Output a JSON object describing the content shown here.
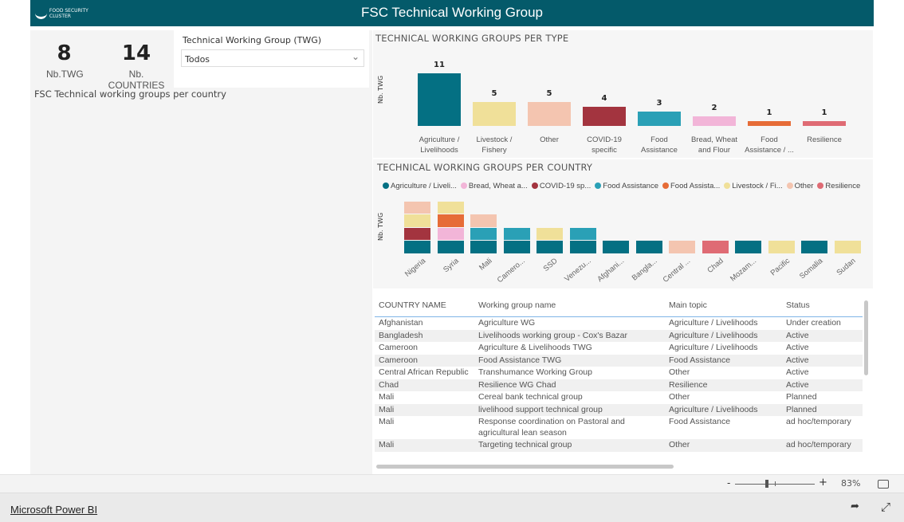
{
  "header": {
    "title": "FSC Technical Working Group",
    "logo_text": "FOOD SECURITY CLUSTER"
  },
  "kpis": [
    {
      "value": "8",
      "label": "Nb.TWG"
    },
    {
      "value": "14",
      "label": "Nb. COUNTRIES"
    }
  ],
  "slicer": {
    "title": "Technical Working Group (TWG)",
    "value": "Todos"
  },
  "left_title": "FSC Technical working groups per country",
  "colors": {
    "header": "#045a6a",
    "Agriculture / Livelihoods": "#047083",
    "Livestock / Fishery": "#f0e099",
    "Other": "#f4c5b0",
    "COVID-19 specific": "#a3343f",
    "Food Assistance": "#2aa0b6",
    "Bread, Wheat and Flour": "#f2b5d8",
    "Food Assistance / ...": "#e66c37",
    "Resilience": "#df6b74"
  },
  "chart_data": [
    {
      "type": "bar",
      "title": "TECHNICAL WORKING GROUPS PER TYPE",
      "ylabel": "Nb. TWG",
      "xlabel": "",
      "categories": [
        "Agriculture / Livelihoods",
        "Livestock / Fishery",
        "Other",
        "COVID-19 specific",
        "Food Assistance",
        "Bread, Wheat and Flour",
        "Food Assistance / ...",
        "Resilience"
      ],
      "values": [
        11,
        5,
        5,
        4,
        3,
        2,
        1,
        1
      ],
      "data_labels": true
    },
    {
      "type": "bar",
      "stacked": true,
      "title": "TECHNICAL WORKING GROUPS PER COUNTRY",
      "ylabel": "Nb. TWG",
      "legend_position": "top",
      "legend": [
        "Agriculture / Liveli...",
        "Bread, Wheat a...",
        "COVID-19 sp...",
        "Food Assistance",
        "Food Assista...",
        "Livestock / Fi...",
        "Other",
        "Resilience"
      ],
      "categories": [
        "Nigeria",
        "Syria",
        "Mali",
        "Camero...",
        "SSD",
        "Venezu...",
        "Afghani...",
        "Bangla...",
        "Central ...",
        "Chad",
        "Mozam...",
        "Pacific",
        "Somalia",
        "Sudan"
      ],
      "series": [
        {
          "name": "Agriculture / Livelihoods",
          "values": [
            1,
            1,
            1,
            1,
            1,
            1,
            1,
            1,
            0,
            0,
            1,
            0,
            1,
            0
          ]
        },
        {
          "name": "Bread, Wheat and Flour",
          "values": [
            0,
            1,
            0,
            0,
            0,
            0,
            0,
            0,
            0,
            0,
            0,
            0,
            0,
            0
          ]
        },
        {
          "name": "COVID-19 specific",
          "values": [
            1,
            0,
            0,
            0,
            0,
            0,
            0,
            0,
            0,
            0,
            0,
            0,
            0,
            0
          ]
        },
        {
          "name": "Food Assistance",
          "values": [
            0,
            0,
            1,
            1,
            0,
            1,
            0,
            0,
            0,
            0,
            0,
            0,
            0,
            0
          ]
        },
        {
          "name": "Food Assistance / ...",
          "values": [
            0,
            1,
            0,
            0,
            0,
            0,
            0,
            0,
            0,
            0,
            0,
            0,
            0,
            0
          ]
        },
        {
          "name": "Livestock / Fishery",
          "values": [
            1,
            1,
            0,
            0,
            1,
            0,
            0,
            0,
            0,
            0,
            0,
            1,
            0,
            1
          ]
        },
        {
          "name": "Other",
          "values": [
            1,
            0,
            1,
            0,
            0,
            0,
            0,
            0,
            1,
            0,
            0,
            0,
            0,
            0
          ]
        },
        {
          "name": "Resilience",
          "values": [
            0,
            0,
            0,
            0,
            0,
            0,
            0,
            0,
            0,
            1,
            0,
            0,
            0,
            0
          ]
        }
      ]
    }
  ],
  "table": {
    "columns": [
      "COUNTRY NAME",
      "Working group name",
      "Main topic",
      "Status"
    ],
    "rows": [
      [
        "Afghanistan",
        "Agriculture WG",
        "Agriculture / Livelihoods",
        "Under creation"
      ],
      [
        "Bangladesh",
        "Livelihoods working group - Cox's Bazar",
        "Agriculture / Livelihoods",
        "Active"
      ],
      [
        "Cameroon",
        "Agriculture & Livelihoods TWG",
        "Agriculture / Livelihoods",
        "Active"
      ],
      [
        "Cameroon",
        "Food Assistance TWG",
        "Food Assistance",
        "Active"
      ],
      [
        "Central African Republic",
        "Transhumance Working Group",
        "Other",
        "Active"
      ],
      [
        "Chad",
        "Resilience WG Chad",
        "Resilience",
        "Active"
      ],
      [
        "Mali",
        "Cereal bank technical group",
        "Other",
        "Planned"
      ],
      [
        "Mali",
        "livelihood support technical group",
        "Agriculture / Livelihoods",
        "Planned"
      ],
      [
        "Mali",
        "Response coordination on Pastoral and agricultural lean season",
        "Food Assistance",
        "ad hoc/temporary"
      ],
      [
        "Mali",
        "Targeting technical group",
        "Other",
        "ad hoc/temporary"
      ]
    ]
  },
  "zoom": {
    "minus": "-",
    "plus": "+",
    "level": "83%",
    "percent": 83
  },
  "footer": {
    "link": "Microsoft Power BI"
  }
}
